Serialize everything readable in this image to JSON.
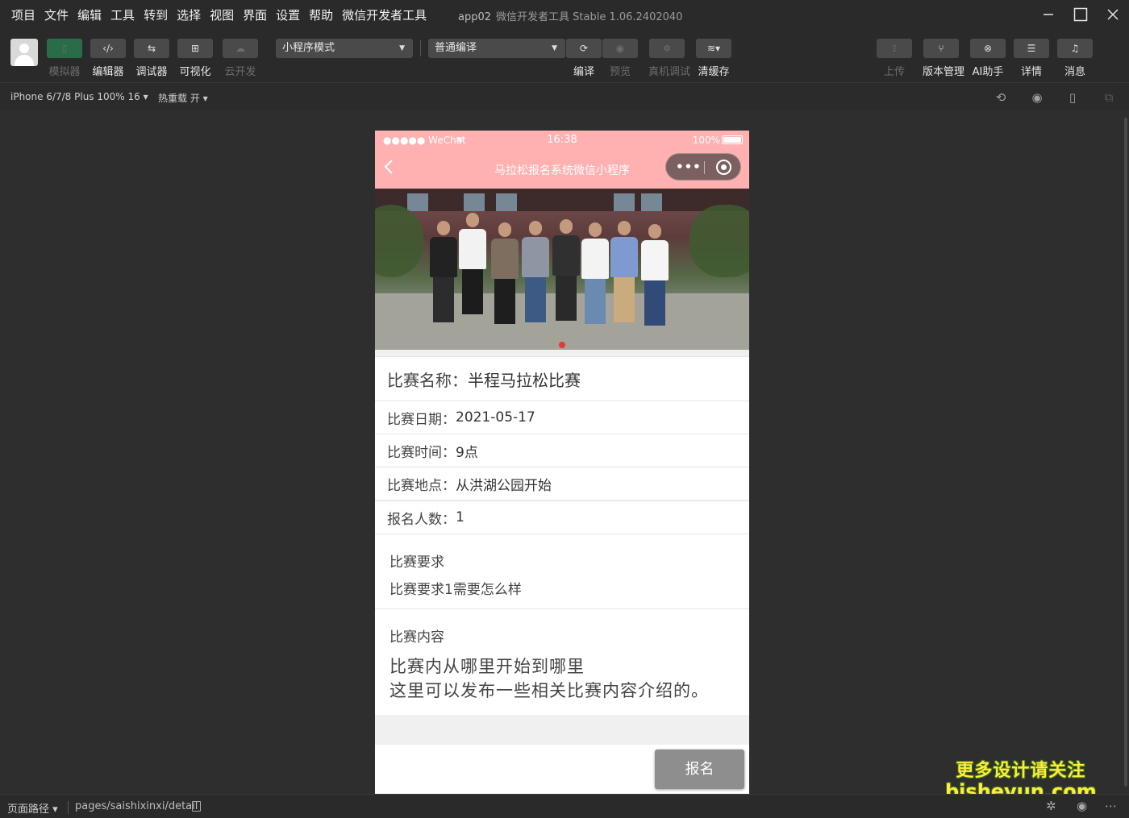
{
  "menu": [
    "项目",
    "文件",
    "编辑",
    "工具",
    "转到",
    "选择",
    "视图",
    "界面",
    "设置",
    "帮助",
    "微信开发者工具"
  ],
  "window": {
    "app": "app02",
    "title": "微信开发者工具 Stable 1.06.2402040"
  },
  "toolbar": {
    "left": [
      {
        "label": "模拟器",
        "icon": "phone-icon",
        "glyph": "▯"
      },
      {
        "label": "编辑器",
        "icon": "code-icon",
        "glyph": "‹/›"
      },
      {
        "label": "调试器",
        "icon": "debug-icon",
        "glyph": "⇆"
      },
      {
        "label": "可视化",
        "icon": "layout-icon",
        "glyph": "⊞"
      },
      {
        "label": "云开发",
        "icon": "cloud-icon",
        "glyph": "☁"
      }
    ],
    "mode_select": "小程序模式",
    "compile_select": "普通编译",
    "mid": [
      {
        "label": "编译",
        "icon": "refresh-icon",
        "glyph": "⟳"
      },
      {
        "label": "预览",
        "icon": "eye-icon",
        "glyph": "◉"
      },
      {
        "label": "真机调试",
        "icon": "bug-icon",
        "glyph": "✲"
      },
      {
        "label": "清缓存",
        "icon": "layers-icon",
        "glyph": "≋▾"
      }
    ],
    "right": [
      {
        "label": "上传",
        "icon": "upload-icon",
        "glyph": "⇪"
      },
      {
        "label": "版本管理",
        "icon": "branch-icon",
        "glyph": "⑂"
      },
      {
        "label": "AI助手",
        "icon": "ai-icon",
        "glyph": "⊗"
      },
      {
        "label": "详情",
        "icon": "menu-icon",
        "glyph": "☰"
      },
      {
        "label": "消息",
        "icon": "bell-icon",
        "glyph": "♫"
      }
    ]
  },
  "subbar": {
    "device": "iPhone 6/7/8 Plus 100% 16 ▾",
    "hot_reload": "热重载 开 ▾"
  },
  "phone": {
    "carrier": "●●●●● WeChat",
    "time": "16:38",
    "battery": "100%",
    "nav_title": "马拉松报名系统微信小程序",
    "race_name_label": "比赛名称：",
    "race_name": "半程马拉松比赛",
    "fields": [
      {
        "k": "比赛日期：",
        "v": "2021-05-17"
      },
      {
        "k": "比赛时间：",
        "v": "9点"
      },
      {
        "k": "比赛地点：",
        "v": "从洪湖公园开始"
      },
      {
        "k": "报名人数：",
        "v": "1"
      }
    ],
    "requirement_title": "比赛要求",
    "requirement_text": "比赛要求1需要怎么样",
    "content_title": "比赛内容",
    "content_line1": "比赛内从哪里开始到哪里",
    "content_line2": "这里可以发布一些相关比赛内容介绍的。",
    "signup": "报名"
  },
  "watermark": {
    "line1": "更多设计请关注",
    "line2": "bisheyun.com"
  },
  "footer": {
    "path_label": "页面路径 ▾",
    "path": "pages/saishixinxi/detail"
  }
}
